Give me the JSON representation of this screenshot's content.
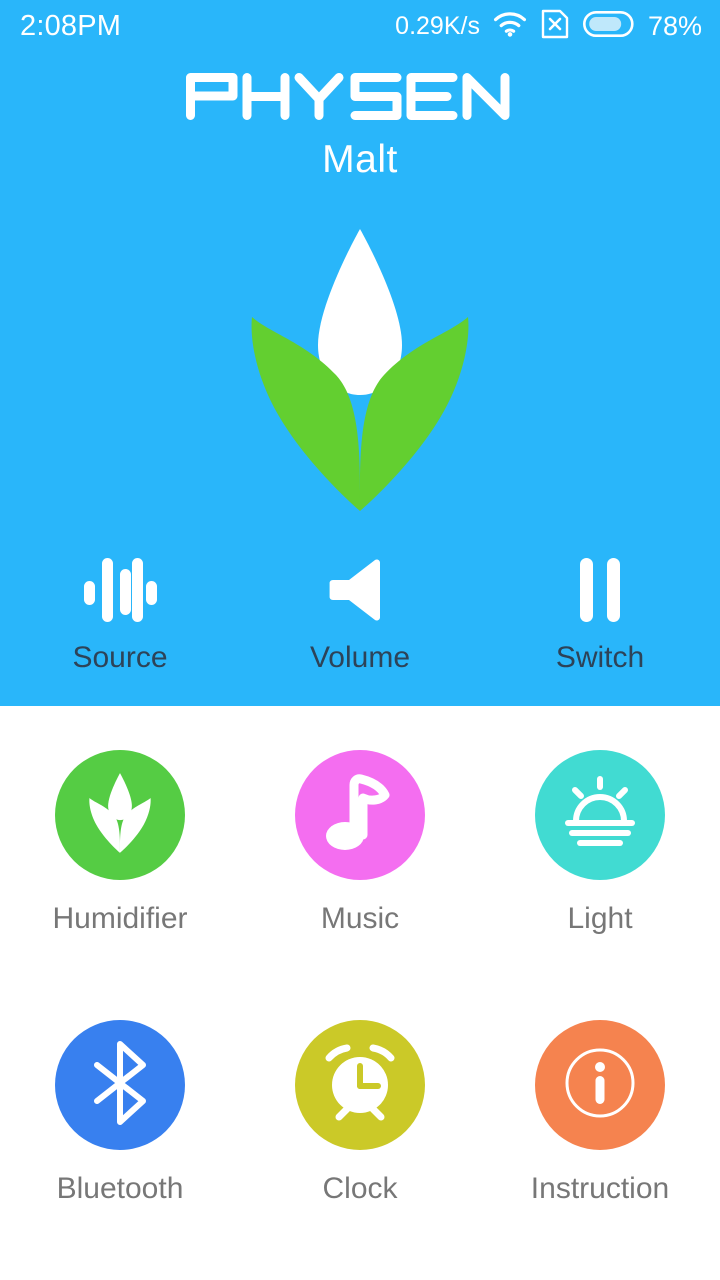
{
  "status_bar": {
    "time": "2:08PM",
    "network_speed": "0.29K/s",
    "wifi_icon": "wifi-icon",
    "sim_icon": "sim-card-disabled-icon",
    "battery_icon": "battery-icon",
    "battery_percent": "78%"
  },
  "header": {
    "brand": "PHYSEN",
    "device_name": "Malt",
    "hero_icon": "plant-droplet-logo",
    "hero_bg_color": "#29b6fa"
  },
  "controls": [
    {
      "label": "Source",
      "icon": "equalizer-icon"
    },
    {
      "label": "Volume",
      "icon": "speaker-icon"
    },
    {
      "label": "Switch",
      "icon": "pause-icon"
    }
  ],
  "control_label_color": "#2d4358",
  "menu": [
    {
      "label": "Humidifier",
      "icon": "plant-droplet-icon",
      "color": "#55cc44"
    },
    {
      "label": "Music",
      "icon": "music-note-icon",
      "color": "#f46ef0"
    },
    {
      "label": "Light",
      "icon": "sunrise-icon",
      "color": "#41dbd2"
    },
    {
      "label": "Bluetooth",
      "icon": "bluetooth-icon",
      "color": "#3880ef"
    },
    {
      "label": "Clock",
      "icon": "alarm-clock-icon",
      "color": "#cbc928"
    },
    {
      "label": "Instruction",
      "icon": "info-icon",
      "color": "#f5834f"
    }
  ],
  "menu_label_color": "#777777"
}
